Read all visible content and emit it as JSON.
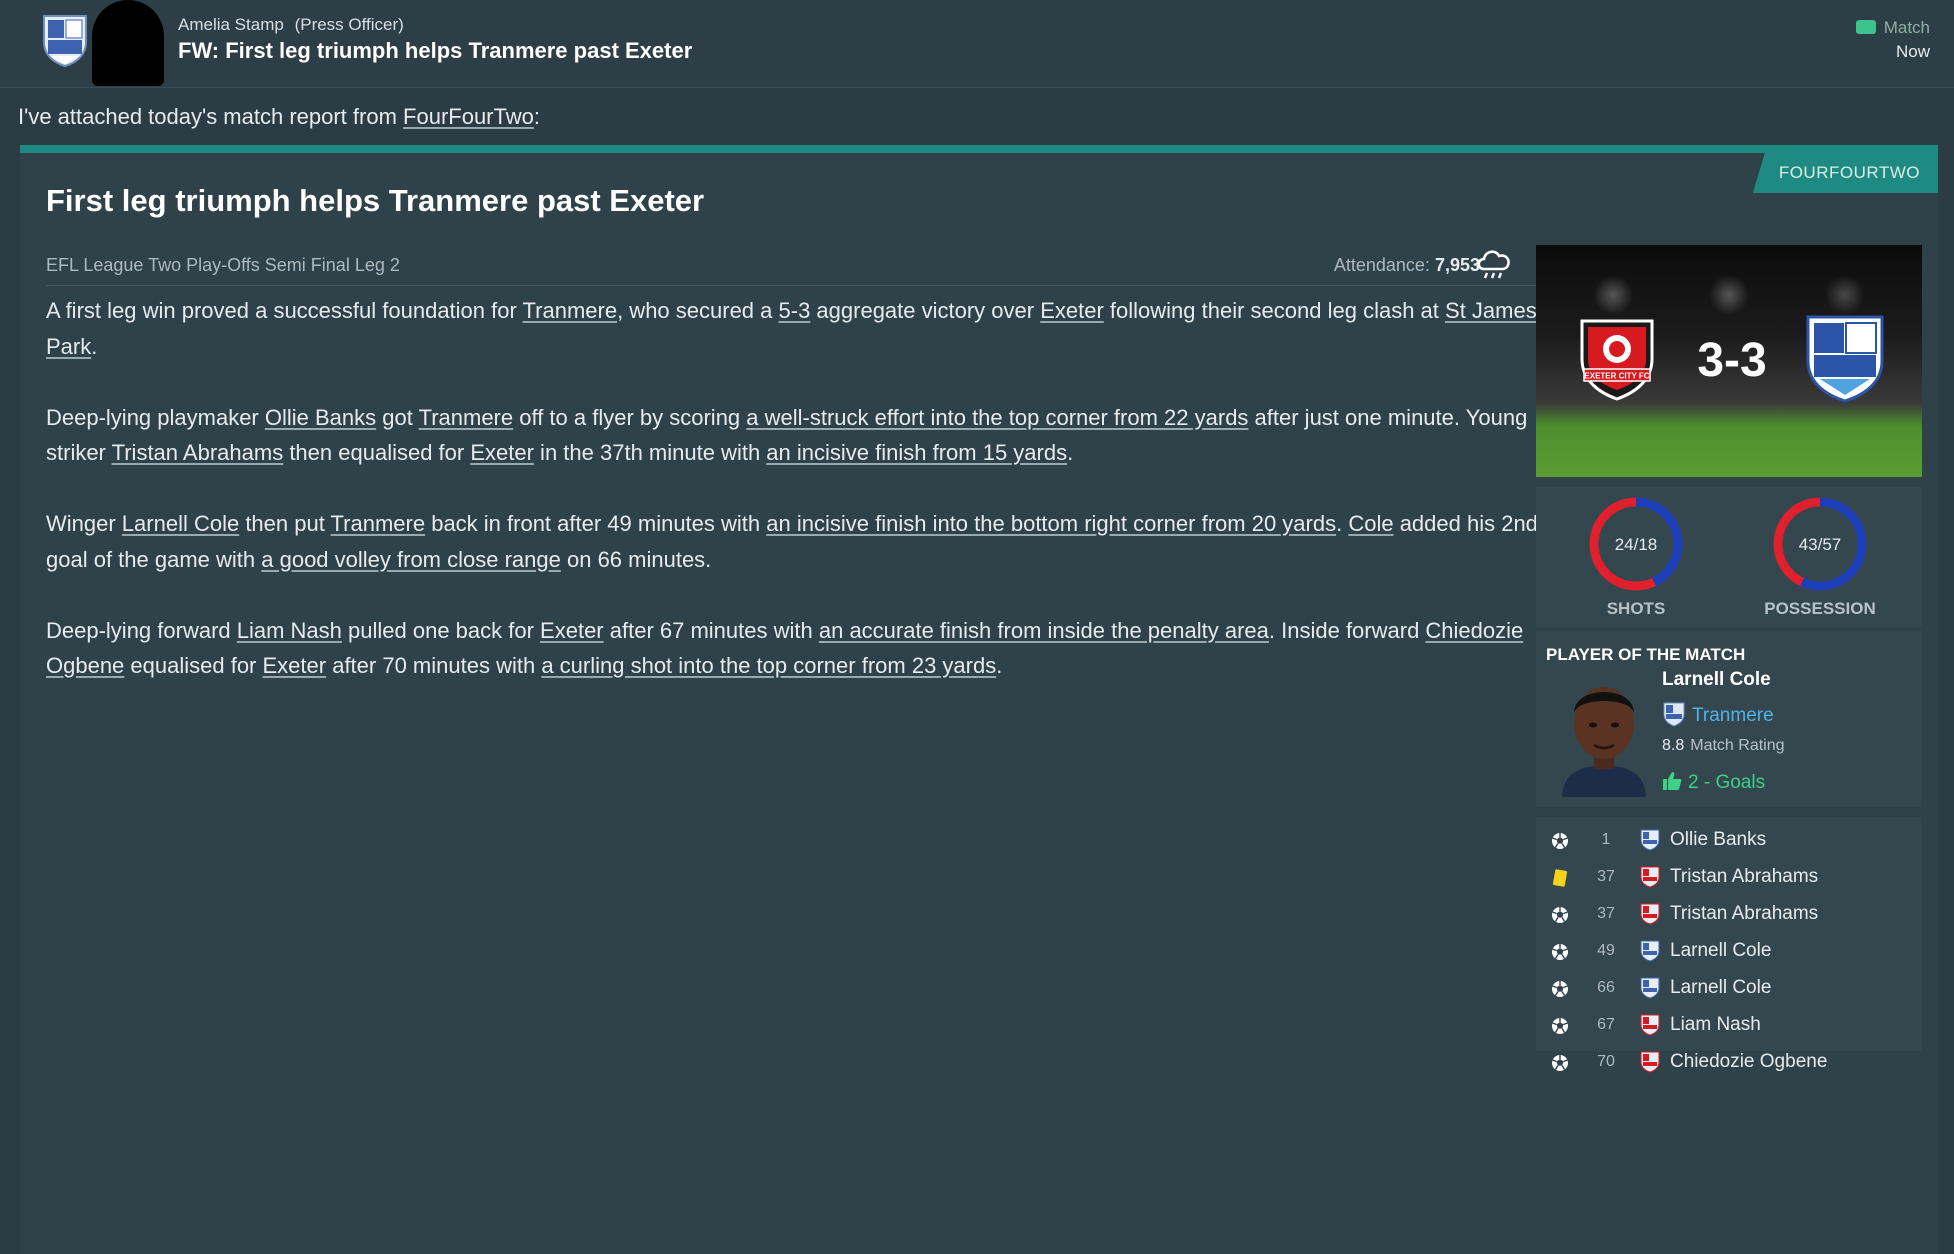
{
  "header": {
    "sender_name": "Amelia Stamp",
    "sender_role": "(Press Officer)",
    "subject": "FW: First leg triumph helps Tranmere past Exeter",
    "tag": "Match",
    "time": "Now"
  },
  "intro": {
    "before": "I've attached today's match report from ",
    "link": "FourFourTwo",
    "after": ":"
  },
  "article": {
    "source": "FOURFOURTWO",
    "title": "First leg triumph helps Tranmere past Exeter",
    "competition": "EFL League Two Play-Offs Semi Final Leg 2",
    "attendance_label": "Attendance:",
    "attendance_value": "7,953",
    "weather_icon": "rain-cloud-icon",
    "paragraphs": [
      {
        "s1": "A first leg win proved a successful foundation for ",
        "l1": "Tranmere",
        "s2": ", who secured a ",
        "l2": "5-3",
        "s3": " aggregate victory over ",
        "l3": "Exeter",
        "s4": " following their second leg clash at ",
        "l4": "St James Park",
        "s5": "."
      },
      {
        "s1": "Deep-lying playmaker ",
        "l1": "Ollie Banks",
        "s2": " got ",
        "l2": "Tranmere",
        "s3": " off to a flyer by scoring ",
        "l3": "a well-struck effort into the top corner from 22 yards",
        "s4": " after just one minute. Young striker ",
        "l4": "Tristan Abrahams",
        "s5": " then equalised for ",
        "l5": "Exeter",
        "s6": " in the 37th minute with ",
        "l6": "an incisive finish from 15 yards",
        "s7": "."
      },
      {
        "s1": "Winger ",
        "l1": "Larnell Cole",
        "s2": " then put ",
        "l2": "Tranmere",
        "s3": " back in front after 49 minutes with ",
        "l3": "an incisive finish into the bottom right corner from 20 yards",
        "s4": ". ",
        "l4": "Cole",
        "s5": " added his 2nd goal of the game with ",
        "l5": "a good volley from close range",
        "s6": " on 66 minutes."
      },
      {
        "s1": "Deep-lying forward ",
        "l1": "Liam Nash",
        "s2": " pulled one back for ",
        "l2": "Exeter",
        "s3": " after 67 minutes with ",
        "l3": "an accurate finish from inside the penalty area",
        "s4": ". Inside forward ",
        "l4": "Chiedozie Ogbene",
        "s5": " equalised for ",
        "l5": "Exeter",
        "s6": " after 70 minutes with ",
        "l6": "a curling shot into the top corner from 23 yards",
        "s7": "."
      }
    ]
  },
  "match": {
    "home_crest": "exeter-crest-icon",
    "home_crest_text": "EXETER CITY FC",
    "away_crest": "tranmere-crest-icon",
    "score": "3-3",
    "stats": [
      {
        "label": "SHOTS",
        "value": "24/18",
        "home": 24,
        "away": 18
      },
      {
        "label": "POSSESSION",
        "value": "43/57",
        "home": 43,
        "away": 57
      }
    ],
    "colors": {
      "home": "#e0202c",
      "away": "#1b3fb8"
    }
  },
  "potm": {
    "heading": "PLAYER OF THE MATCH",
    "name": "Larnell Cole",
    "club": "Tranmere",
    "rating": "8.8",
    "rating_label": "Match Rating",
    "goals": "2 - Goals"
  },
  "events": [
    {
      "type": "goal",
      "icon": "football-icon",
      "minute": "1",
      "team": "tranmere",
      "player": "Ollie Banks"
    },
    {
      "type": "yellow",
      "icon": "yellow-card-icon",
      "minute": "37",
      "team": "exeter",
      "player": "Tristan Abrahams"
    },
    {
      "type": "goal",
      "icon": "football-icon",
      "minute": "37",
      "team": "exeter",
      "player": "Tristan Abrahams"
    },
    {
      "type": "goal",
      "icon": "football-icon",
      "minute": "49",
      "team": "tranmere",
      "player": "Larnell Cole"
    },
    {
      "type": "goal",
      "icon": "football-icon",
      "minute": "66",
      "team": "tranmere",
      "player": "Larnell Cole"
    },
    {
      "type": "goal",
      "icon": "football-icon",
      "minute": "67",
      "team": "exeter",
      "player": "Liam Nash"
    },
    {
      "type": "goal",
      "icon": "football-icon",
      "minute": "70",
      "team": "exeter",
      "player": "Chiedozie Ogbene"
    }
  ]
}
